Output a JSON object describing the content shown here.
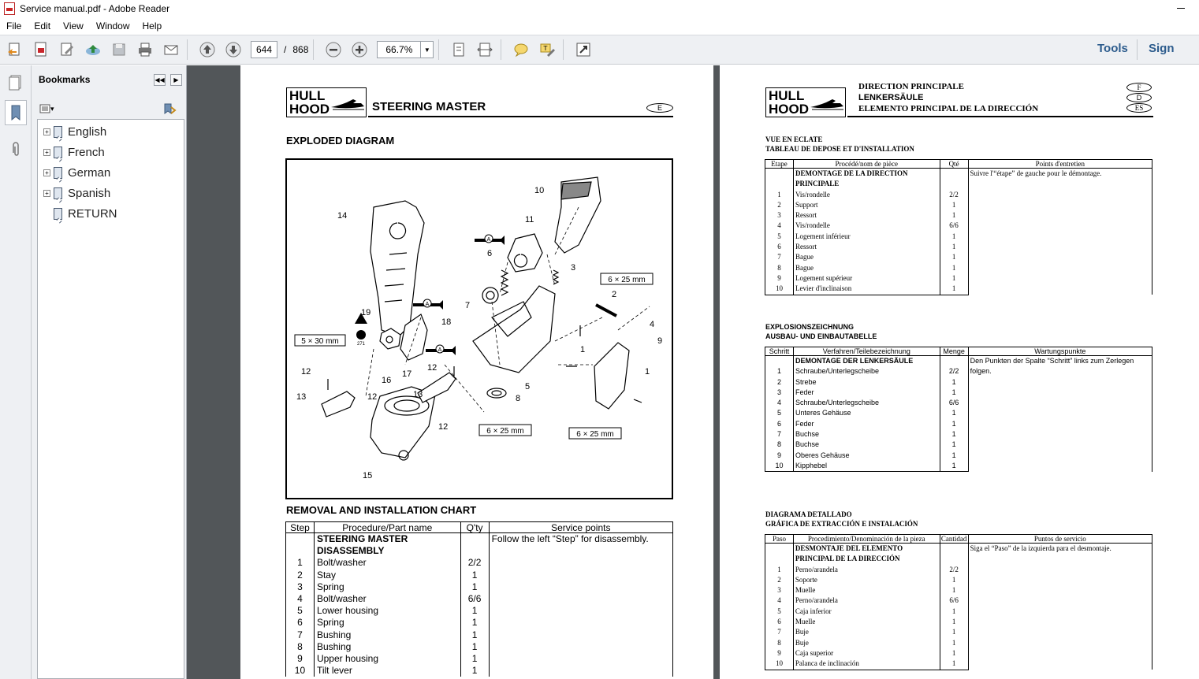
{
  "window": {
    "title": "Service manual.pdf - Adobe Reader"
  },
  "menu": [
    "File",
    "Edit",
    "View",
    "Window",
    "Help"
  ],
  "toolbar": {
    "page_current": "644",
    "page_separator": "/",
    "page_total": "868",
    "zoom": "66.7%",
    "tools_label": "Tools",
    "sign_label": "Sign"
  },
  "bookmarks": {
    "title": "Bookmarks",
    "items": [
      {
        "label": "English",
        "expandable": true
      },
      {
        "label": "French",
        "expandable": true
      },
      {
        "label": "German",
        "expandable": true
      },
      {
        "label": "Spanish",
        "expandable": true
      },
      {
        "label": "RETURN",
        "expandable": false
      }
    ]
  },
  "page1": {
    "hull_top": "HULL",
    "hull_bottom": "HOOD",
    "title": "STEERING MASTER",
    "lang_badge": "E",
    "exploded_heading": "EXPLODED DIAGRAM",
    "diagram_labels": {
      "n1": "1",
      "n2": "2",
      "n3": "3",
      "n4": "4",
      "n5": "5",
      "n6": "6",
      "n7": "7",
      "n8": "8",
      "n9": "9",
      "n10": "10",
      "n11": "11",
      "n12": "12",
      "n13": "13",
      "n14": "14",
      "n15": "15",
      "n16": "16",
      "n17": "17",
      "n18": "18",
      "n19": "19",
      "size_5x30": "5 × 30 mm",
      "size_6x25": "6 × 25 mm",
      "marker_a": "A",
      "marker_271": "271"
    },
    "chart_heading": "REMOVAL AND INSTALLATION CHART",
    "chart_headers": [
      "Step",
      "Procedure/Part name",
      "Q'ty",
      "Service points"
    ],
    "chart_title_line1": "STEERING MASTER",
    "chart_title_line2": "DISASSEMBLY",
    "chart_note": "Follow the left “Step” for disassembly.",
    "rows": [
      {
        "step": "1",
        "part": "Bolt/washer",
        "qty": "2/2"
      },
      {
        "step": "2",
        "part": "Stay",
        "qty": "1"
      },
      {
        "step": "3",
        "part": "Spring",
        "qty": "1"
      },
      {
        "step": "4",
        "part": "Bolt/washer",
        "qty": "6/6"
      },
      {
        "step": "5",
        "part": "Lower housing",
        "qty": "1"
      },
      {
        "step": "6",
        "part": "Spring",
        "qty": "1"
      },
      {
        "step": "7",
        "part": "Bushing",
        "qty": "1"
      },
      {
        "step": "8",
        "part": "Bushing",
        "qty": "1"
      },
      {
        "step": "9",
        "part": "Upper housing",
        "qty": "1"
      },
      {
        "step": "10",
        "part": "Tilt lever",
        "qty": "1"
      }
    ]
  },
  "page2": {
    "hull_top": "HULL",
    "hull_bottom": "HOOD",
    "title_fr": "DIRECTION PRINCIPALE",
    "title_de": "LENKERSÄULE",
    "title_es": "ELEMENTO PRINCIPAL DE LA DIRECCIÓN",
    "badges": [
      "F",
      "D",
      "ES"
    ],
    "fr": {
      "heading1": "VUE EN ECLATE",
      "heading2": "TABLEAU DE DEPOSE ET D'INSTALLATION",
      "headers": [
        "Etape",
        "Procédé/nom de pièce",
        "Qté",
        "Points d'entretien"
      ],
      "title1": "DEMONTAGE DE LA DIRECTION",
      "title2": "PRINCIPALE",
      "note": "Suivre l'“étape” de gauche pour le démontage.",
      "rows": [
        {
          "step": "1",
          "part": "Vis/rondelle",
          "qty": "2/2"
        },
        {
          "step": "2",
          "part": "Support",
          "qty": "1"
        },
        {
          "step": "3",
          "part": "Ressort",
          "qty": "1"
        },
        {
          "step": "4",
          "part": "Vis/rondelle",
          "qty": "6/6"
        },
        {
          "step": "5",
          "part": "Logement inférieur",
          "qty": "1"
        },
        {
          "step": "6",
          "part": "Ressort",
          "qty": "1"
        },
        {
          "step": "7",
          "part": " Bague",
          "qty": "1"
        },
        {
          "step": "8",
          "part": "Bague",
          "qty": "1"
        },
        {
          "step": "9",
          "part": "Logement supérieur",
          "qty": "1"
        },
        {
          "step": "10",
          "part": "Levier d'inclinaison",
          "qty": "1"
        }
      ]
    },
    "de": {
      "heading1": "EXPLOSIONSZEICHNUNG",
      "heading2": "AUSBAU- UND EINBAUTABELLE",
      "headers": [
        "Schritt",
        "Verfahren/Teilebezeichnung",
        "Menge",
        "Wartungspunkte"
      ],
      "title1": "DEMONTAGE DER LENKERSÄULE",
      "note": "Den Punkten der Spalte “Schritt” links zum Zerlegen folgen.",
      "rows": [
        {
          "step": "1",
          "part": "Schraube/Unterlegscheibe",
          "qty": "2/2"
        },
        {
          "step": "2",
          "part": "Strebe",
          "qty": "1"
        },
        {
          "step": "3",
          "part": "Feder",
          "qty": "1"
        },
        {
          "step": "4",
          "part": "Schraube/Unterlegscheibe",
          "qty": "6/6"
        },
        {
          "step": "5",
          "part": "Unteres Gehäuse",
          "qty": "1"
        },
        {
          "step": "6",
          "part": "Feder",
          "qty": "1"
        },
        {
          "step": "7",
          "part": "Buchse",
          "qty": "1"
        },
        {
          "step": "8",
          "part": "Buchse",
          "qty": "1"
        },
        {
          "step": "9",
          "part": "Oberes Gehäuse",
          "qty": "1"
        },
        {
          "step": "10",
          "part": "Kipphebel",
          "qty": "1"
        }
      ]
    },
    "es": {
      "heading1": "DIAGRAMA DETALLADO",
      "heading2": "GRÁFICA DE EXTRACCIÓN E INSTALACIÓN",
      "headers": [
        "Paso",
        "Procedimiento/Denominación de la pieza",
        "Cantidad",
        "Puntos de servicio"
      ],
      "title1": "DESMONTAJE DEL ELEMENTO",
      "title2": "PRINCIPAL DE LA DIRECCIÓN",
      "note": "Siga el “Paso” de la izquierda para el desmontaje.",
      "rows": [
        {
          "step": "1",
          "part": "Perno/arandela",
          "qty": "2/2"
        },
        {
          "step": "2",
          "part": "Soporte",
          "qty": "1"
        },
        {
          "step": "3",
          "part": "Muelle",
          "qty": "1"
        },
        {
          "step": "4",
          "part": "Perno/arandela",
          "qty": "6/6"
        },
        {
          "step": "5",
          "part": "Caja inferior",
          "qty": "1"
        },
        {
          "step": "6",
          "part": "Muelle",
          "qty": "1"
        },
        {
          "step": "7",
          "part": "Buje",
          "qty": "1"
        },
        {
          "step": "8",
          "part": "Buje",
          "qty": "1"
        },
        {
          "step": "9",
          "part": "Caja superior",
          "qty": "1"
        },
        {
          "step": "10",
          "part": "Palanca de inclinación",
          "qty": "1"
        }
      ]
    }
  }
}
